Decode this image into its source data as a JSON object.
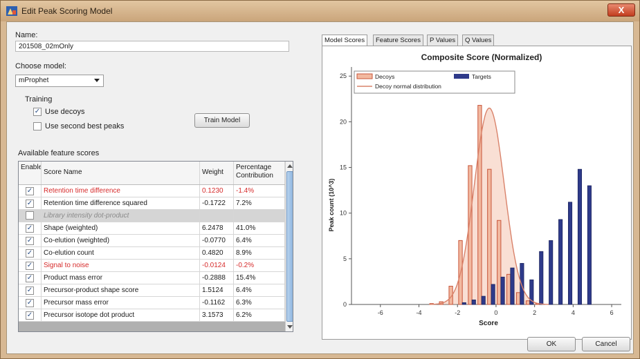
{
  "window": {
    "title": "Edit Peak Scoring Model",
    "close_label": "X"
  },
  "form": {
    "name_label": "Name:",
    "name_value": "201508_02mOnly",
    "choose_model_label": "Choose model:",
    "model_value": "mProphet",
    "training_label": "Training",
    "use_decoys_label": "Use decoys",
    "use_decoys_checked": true,
    "use_second_best_label": "Use second best peaks",
    "use_second_best_checked": false,
    "train_button": "Train Model",
    "features_label": "Available feature scores"
  },
  "table": {
    "headers": [
      "Enable",
      "Score Name",
      "Weight",
      "Percentage Contribution"
    ],
    "rows": [
      {
        "enabled": true,
        "name": "Retention time difference",
        "weight": "0.1230",
        "pct": "-1.4%",
        "style": "red"
      },
      {
        "enabled": true,
        "name": "Retention time difference squared",
        "weight": "-0.1722",
        "pct": "7.2%",
        "style": "normal"
      },
      {
        "enabled": false,
        "name": "Library intensity dot-product",
        "weight": "",
        "pct": "",
        "style": "gray"
      },
      {
        "enabled": true,
        "name": "Shape (weighted)",
        "weight": "6.2478",
        "pct": "41.0%",
        "style": "normal"
      },
      {
        "enabled": true,
        "name": "Co-elution (weighted)",
        "weight": "-0.0770",
        "pct": "6.4%",
        "style": "normal"
      },
      {
        "enabled": true,
        "name": "Co-elution count",
        "weight": "0.4820",
        "pct": "8.9%",
        "style": "normal"
      },
      {
        "enabled": true,
        "name": "Signal to noise",
        "weight": "-0.0124",
        "pct": "-0.2%",
        "style": "red"
      },
      {
        "enabled": true,
        "name": "Product mass error",
        "weight": "-0.2888",
        "pct": "15.4%",
        "style": "normal"
      },
      {
        "enabled": true,
        "name": "Precursor-product shape score",
        "weight": "1.5124",
        "pct": "6.4%",
        "style": "normal"
      },
      {
        "enabled": true,
        "name": "Precursor mass error",
        "weight": "-0.1162",
        "pct": "6.3%",
        "style": "normal"
      },
      {
        "enabled": true,
        "name": "Precursor isotope dot product",
        "weight": "3.1573",
        "pct": "6.2%",
        "style": "normal"
      }
    ]
  },
  "tabs": [
    "Model Scores",
    "Feature Scores",
    "P Values",
    "Q Values"
  ],
  "active_tab": "Model Scores",
  "buttons": {
    "ok": "OK",
    "cancel": "Cancel"
  },
  "colors": {
    "decoy_fill": "#f2b9a0",
    "decoy_stroke": "#c8553a",
    "target_fill": "#2e3a8a",
    "curve": "#d9826a"
  },
  "chart_data": {
    "type": "bar",
    "title": "Composite Score (Normalized)",
    "xlabel": "Score",
    "ylabel": "Peak count (10^3)",
    "xlim": [
      -7.5,
      6.5
    ],
    "ylim": [
      0,
      26
    ],
    "xticks": [
      -6,
      -4,
      -2,
      0,
      2,
      4,
      6
    ],
    "yticks": [
      0,
      5,
      10,
      15,
      20,
      25
    ],
    "legend": [
      "Decoys",
      "Targets",
      "Decoy normal distribution"
    ],
    "legend_position": "top-left",
    "x": [
      -6.25,
      -5.75,
      -5.25,
      -4.75,
      -4.25,
      -3.75,
      -3.25,
      -2.75,
      -2.25,
      -1.75,
      -1.25,
      -0.75,
      -0.25,
      0.25,
      0.75,
      1.25,
      1.75,
      2.25,
      2.75,
      3.25,
      3.75,
      4.25,
      4.75,
      5.25,
      5.75
    ],
    "series": [
      {
        "name": "Decoys",
        "values": [
          0,
          0,
          0,
          0,
          0,
          0,
          0.1,
          0.3,
          2.0,
          7.0,
          15.2,
          21.8,
          14.8,
          9.2,
          3.3,
          1.3,
          0.4,
          0.1,
          0,
          0,
          0,
          0,
          0,
          0,
          0
        ]
      },
      {
        "name": "Targets",
        "values": [
          0,
          0,
          0,
          0,
          0,
          0,
          0,
          0,
          0,
          0.2,
          0.5,
          0.9,
          2.2,
          3.0,
          4.0,
          4.5,
          2.7,
          5.8,
          7.0,
          9.3,
          11.2,
          14.8,
          13.0,
          0,
          0
        ]
      }
    ],
    "decoy_normal_mean": -0.35,
    "decoy_normal_sd": 0.78,
    "decoy_normal_peak": 21.5
  }
}
